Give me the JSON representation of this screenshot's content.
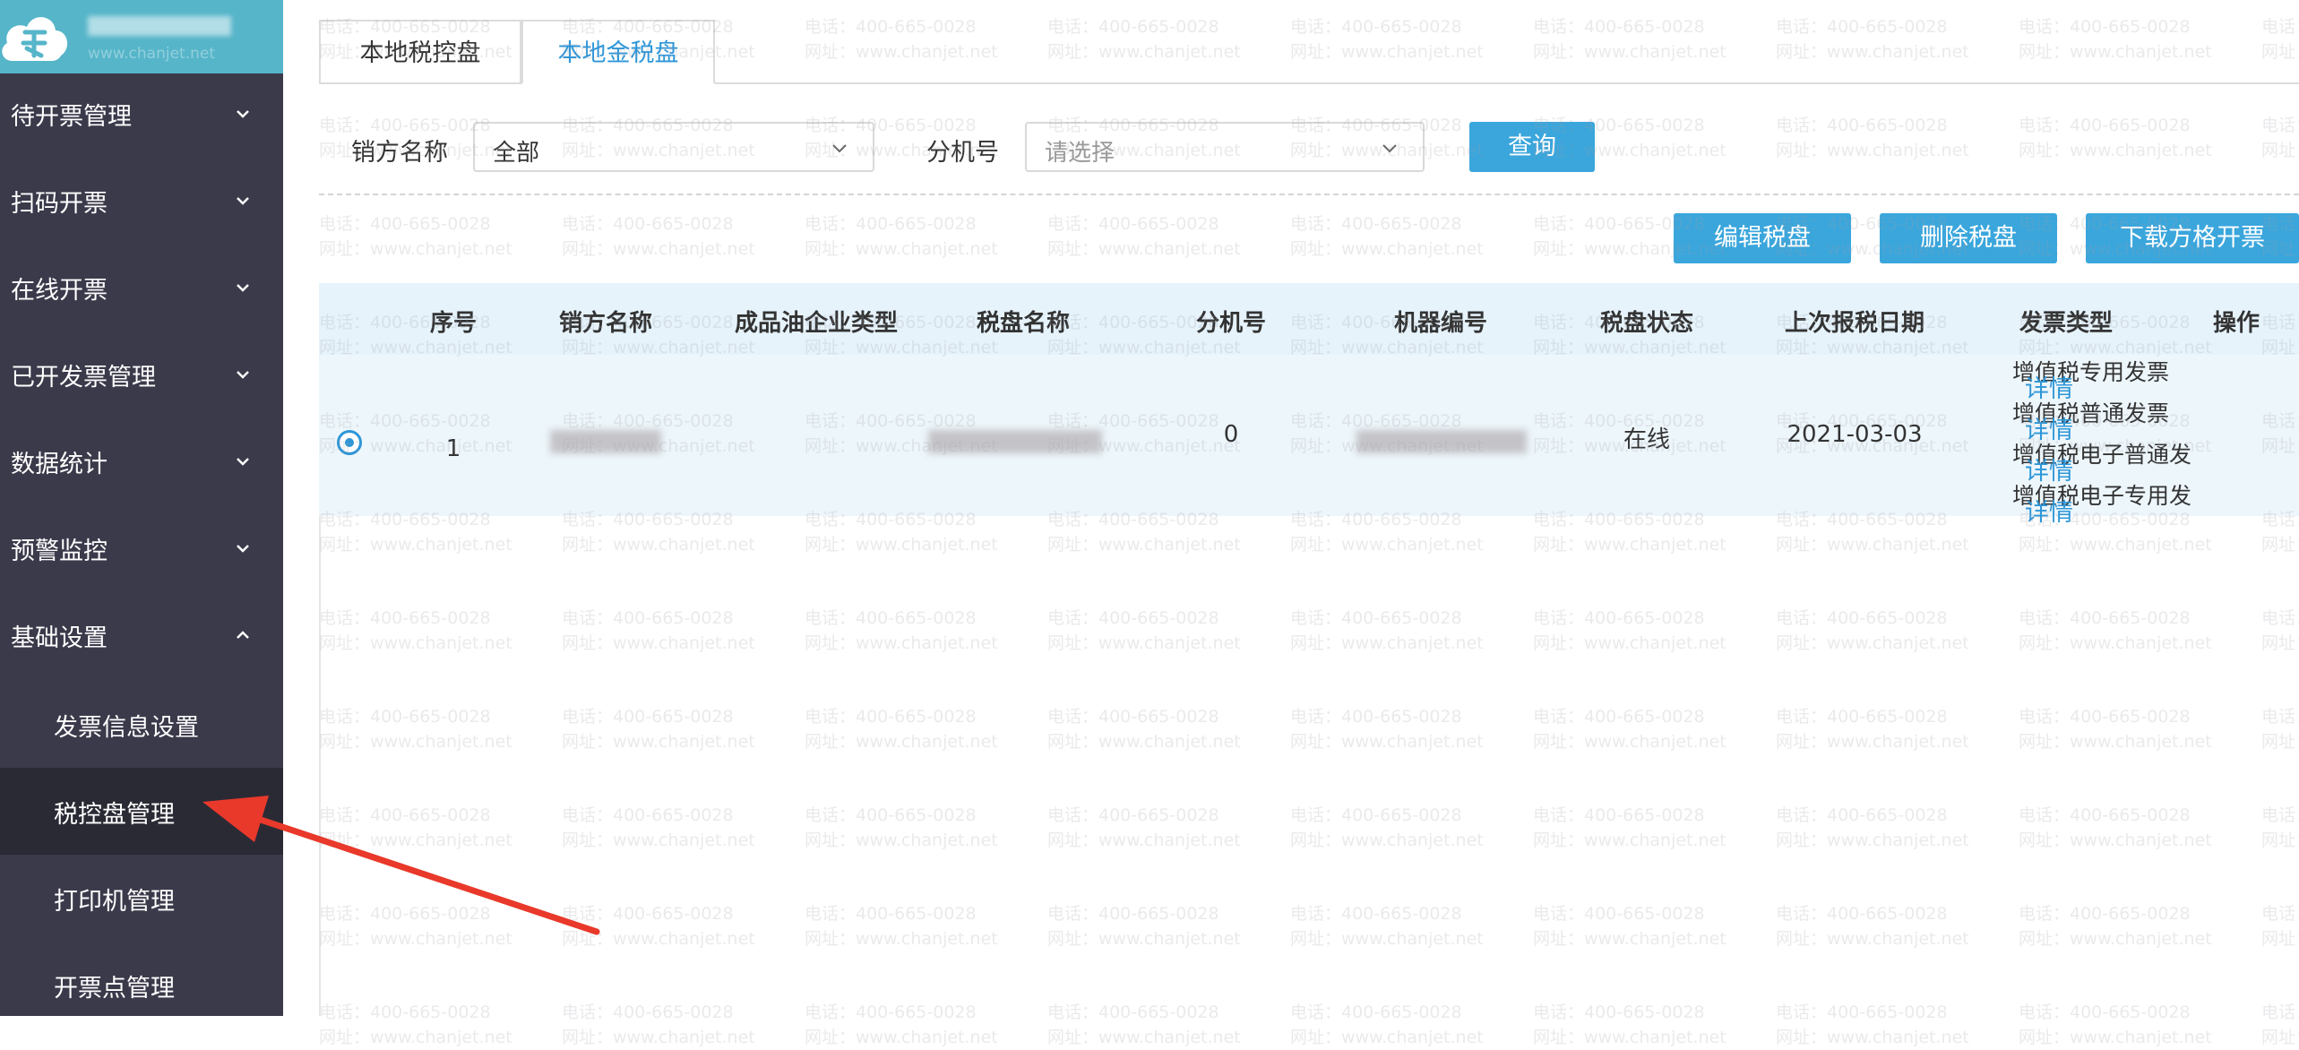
{
  "sidebar": {
    "company_sub": "www.chanjet.net",
    "menu": [
      {
        "label": "待开票管理"
      },
      {
        "label": "扫码开票"
      },
      {
        "label": "在线开票"
      },
      {
        "label": "已开发票管理"
      },
      {
        "label": "数据统计"
      },
      {
        "label": "预警监控"
      },
      {
        "label": "基础设置"
      }
    ],
    "submenu": [
      {
        "label": "发票信息设置"
      },
      {
        "label": "税控盘管理"
      },
      {
        "label": "打印机管理"
      },
      {
        "label": "开票点管理"
      }
    ]
  },
  "tabs": [
    {
      "label": "本地税控盘"
    },
    {
      "label": "本地金税盘"
    }
  ],
  "filters": {
    "seller_label": "销方名称",
    "seller_value": "全部",
    "branch_label": "分机号",
    "branch_placeholder": "请选择",
    "query_label": "查询"
  },
  "actions": {
    "edit": "编辑税盘",
    "delete": "删除税盘",
    "download": "下载方格开票"
  },
  "table": {
    "headers": [
      "序号",
      "销方名称",
      "成品油企业类型",
      "税盘名称",
      "分机号",
      "机器编号",
      "税盘状态",
      "上次报税日期",
      "发票类型",
      "操作"
    ],
    "row": {
      "index": "1",
      "branch": "0",
      "status": "在线",
      "last_tax_date": "2021-03-03",
      "invoice_types": [
        "增值税专用发票",
        "增值税普通发票",
        "增值税电子普通发",
        "增值税电子专用发"
      ],
      "detail_link": "详情"
    }
  },
  "watermark": {
    "line1": "电话：400-665-0028",
    "line2": "网址：www.chanjet.net"
  },
  "colors": {
    "sidebar_bg": "#3b3a4b",
    "header_bg": "#56b5c9",
    "accent": "#3aa6dc",
    "arrow": "#e8392b"
  }
}
